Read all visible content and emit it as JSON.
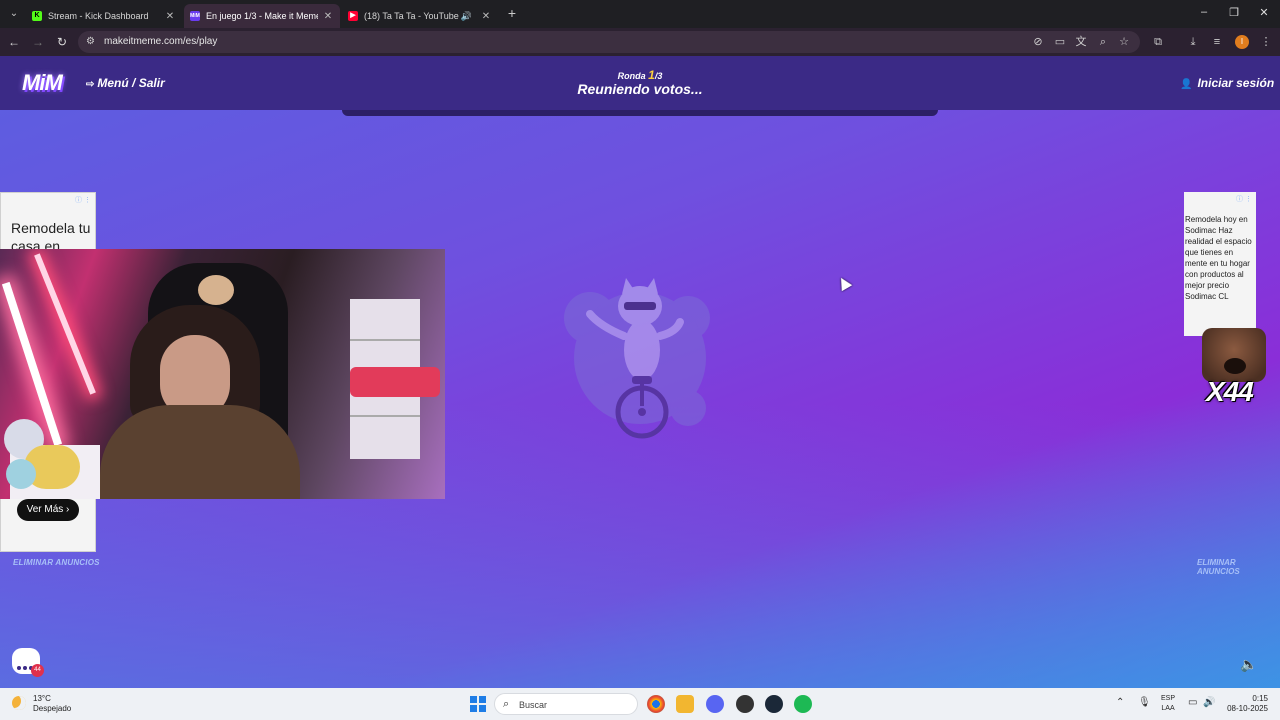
{
  "browser": {
    "tabs": [
      {
        "title": "Stream - Kick Dashboard",
        "favicon": "K",
        "favicon_color": "#53fc18",
        "active": false
      },
      {
        "title": "En juego 1/3 - Make it Meme",
        "favicon": "MiM",
        "favicon_color": "#6a3cf0",
        "active": true
      },
      {
        "title": "(18) Ta Ta Ta - YouTube",
        "favicon": "▶",
        "favicon_color": "#ff0033",
        "active": false
      }
    ],
    "url": "makeitmeme.com/es/play"
  },
  "header": {
    "logo": "MiM",
    "menu_label": "Menú / Salir",
    "round_label": "Ronda",
    "round_current": "1",
    "round_total": "/3",
    "status": "Reuniendo votos...",
    "login_label": "Iniciar sesión"
  },
  "ad_left": {
    "headline": "Remodela tu casa en",
    "cta": "Ver Más",
    "remove_ads": "ELIMINAR ANUNCIOS"
  },
  "ad_right": {
    "text": "Remodela hoy en Sodimac Haz realidad el espacio que tienes en mente en tu hogar con productos al mejor precio Sodimac CL",
    "remove_ads": "ELIMINAR ANUNCIOS"
  },
  "emote": {
    "multiplier": "X44"
  },
  "chat": {
    "badge": "44"
  },
  "taskbar": {
    "temperature": "13°C",
    "condition": "Despejado",
    "search_placeholder": "Buscar",
    "lang_line1": "ESP",
    "lang_line2": "LAA",
    "time": "0:15",
    "date": "08-10-2025"
  },
  "colors": {
    "header_bg": "#3b2a86",
    "accent_yellow": "#ffd23b",
    "page_gradient_start": "#5b5fe0",
    "page_gradient_end": "#8a2ed8"
  }
}
